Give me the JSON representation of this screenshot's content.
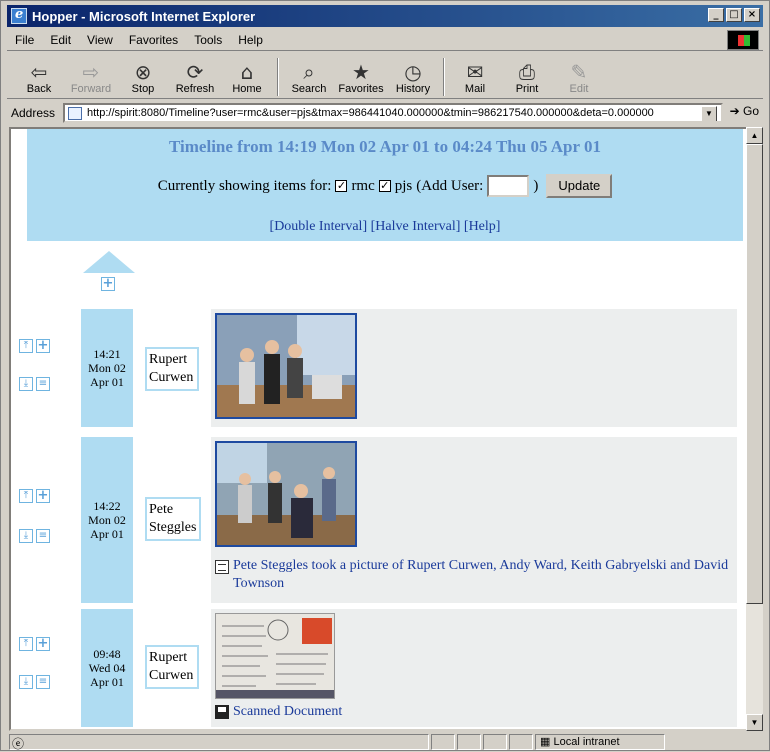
{
  "window": {
    "title": "Hopper - Microsoft Internet Explorer"
  },
  "menu": [
    "File",
    "Edit",
    "View",
    "Favorites",
    "Tools",
    "Help"
  ],
  "toolbar": [
    {
      "label": "Back",
      "icon": "back-arrow-icon",
      "glyph": "⇦"
    },
    {
      "label": "Forward",
      "icon": "forward-arrow-icon",
      "glyph": "⇨"
    },
    {
      "label": "Stop",
      "icon": "stop-icon",
      "glyph": "⊗"
    },
    {
      "label": "Refresh",
      "icon": "refresh-icon",
      "glyph": "⟳"
    },
    {
      "label": "Home",
      "icon": "home-icon",
      "glyph": "⌂"
    },
    {
      "label": "Search",
      "icon": "search-icon",
      "glyph": "⌕"
    },
    {
      "label": "Favorites",
      "icon": "favorites-icon",
      "glyph": "★"
    },
    {
      "label": "History",
      "icon": "history-icon",
      "glyph": "◷"
    },
    {
      "label": "Mail",
      "icon": "mail-icon",
      "glyph": "✉"
    },
    {
      "label": "Print",
      "icon": "print-icon",
      "glyph": "⎙"
    },
    {
      "label": "Edit",
      "icon": "edit-icon",
      "glyph": "✎"
    }
  ],
  "address": {
    "label": "Address",
    "url": "http://spirit:8080/Timeline?user=rmc&user=pjs&tmax=986441040.000000&tmin=986217540.000000&deta=0.000000",
    "go": "Go"
  },
  "page": {
    "title": "Timeline from 14:19 Mon 02 Apr 01 to 04:24 Thu 05 Apr 01",
    "showing_prefix": "Currently showing items for:",
    "users": [
      "rmc",
      "pjs"
    ],
    "add_user_prefix": "(Add User:",
    "add_user_suffix": ")",
    "update_button": "Update",
    "links": [
      "[Double Interval]",
      "[Halve Interval]",
      "[Help]"
    ]
  },
  "items": [
    {
      "time": "14:21",
      "day": "Mon 02",
      "month": "Apr 01",
      "name_first": "Rupert",
      "name_last": "Curwen",
      "caption": ""
    },
    {
      "time": "14:22",
      "day": "Mon 02",
      "month": "Apr 01",
      "name_first": "Pete",
      "name_last": "Steggles",
      "caption": "Pete Steggles took a picture of Rupert Curwen, Andy Ward, Keith Gabryelski and David Townson"
    },
    {
      "time": "09:48",
      "day": "Wed 04",
      "month": "Apr 01",
      "name_first": "Rupert",
      "name_last": "Curwen",
      "caption": "Scanned Document"
    }
  ],
  "status": {
    "zone": "Local intranet"
  },
  "colors": {
    "accent": "#afdcf2",
    "title_text": "#5a8ac8",
    "link": "#1a3a9a",
    "photo_border": "#1e4aa0"
  }
}
